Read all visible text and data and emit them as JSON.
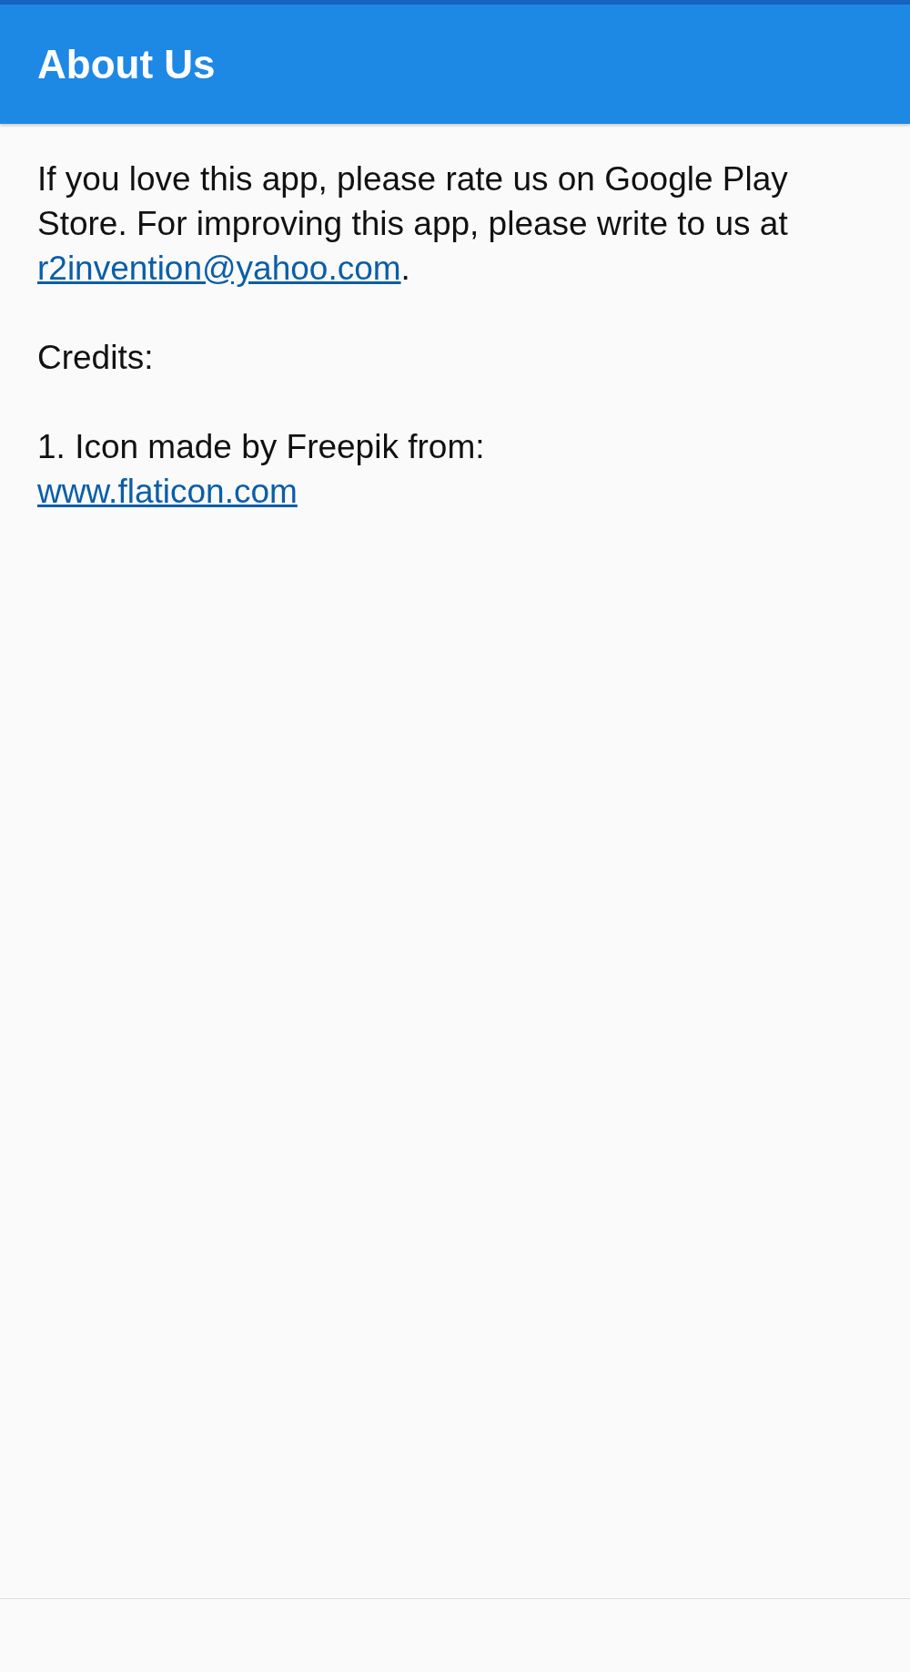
{
  "app_bar": {
    "title": "About Us"
  },
  "content": {
    "intro": {
      "text": "If you love this app, please rate us on Google Play Store. For improving this app, please write to us at",
      "link": "r2invention@yahoo.com",
      "after": "."
    },
    "credits_heading": "Credits:",
    "credits": [
      {
        "text": "1. Icon made by Freepik from:",
        "link": "www.flaticon.com"
      }
    ]
  }
}
